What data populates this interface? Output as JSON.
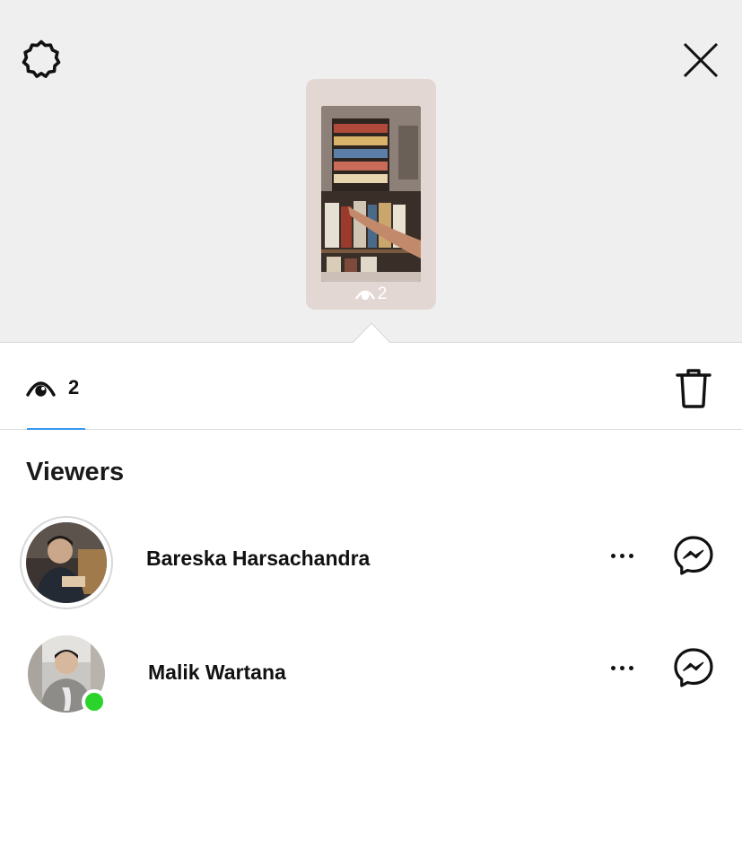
{
  "header": {
    "settings_icon": "settings-gear-icon",
    "close_icon": "close-x-icon"
  },
  "story_preview": {
    "view_count": "2",
    "eye_icon": "eye-icon"
  },
  "tabs": {
    "views_count": "2",
    "accent_color": "#3897f0"
  },
  "viewers": {
    "title": "Viewers",
    "list": [
      {
        "name": "Bareska Harsachandra",
        "online": false,
        "has_story_ring": true
      },
      {
        "name": "Malik Wartana",
        "online": true,
        "has_story_ring": false
      }
    ]
  },
  "colors": {
    "top_background": "#efeff0",
    "online": "#2bd42b"
  }
}
